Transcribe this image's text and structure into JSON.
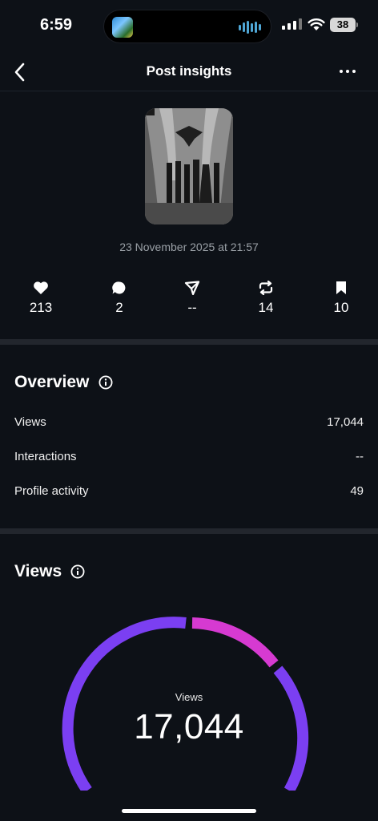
{
  "status_bar": {
    "time": "6:59",
    "battery": "38"
  },
  "header": {
    "title": "Post insights"
  },
  "post": {
    "date": "23 November 2025 at 21:57"
  },
  "stats": [
    {
      "icon": "heart-icon",
      "value": "213"
    },
    {
      "icon": "comment-icon",
      "value": "2"
    },
    {
      "icon": "send-icon",
      "value": "--"
    },
    {
      "icon": "repost-icon",
      "value": "14"
    },
    {
      "icon": "bookmark-icon",
      "value": "10"
    }
  ],
  "overview": {
    "title": "Overview",
    "rows": [
      {
        "label": "Views",
        "value": "17,044"
      },
      {
        "label": "Interactions",
        "value": "--"
      },
      {
        "label": "Profile activity",
        "value": "49"
      }
    ]
  },
  "views": {
    "title": "Views",
    "gauge_label": "Views",
    "gauge_value": "17,044",
    "colors": {
      "primary": "#7b3ff2",
      "secondary": "#d63ad1"
    }
  }
}
